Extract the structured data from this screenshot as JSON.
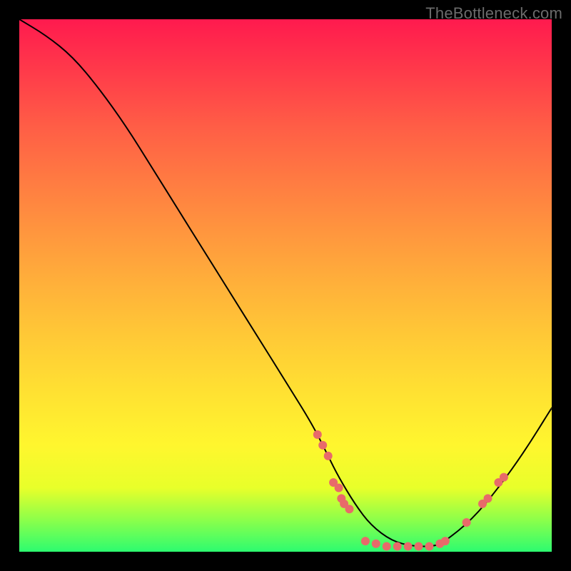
{
  "watermark": "TheBottleneck.com",
  "colors": {
    "background": "#000000",
    "gradient_top": "#ff1a4e",
    "gradient_bottom": "#2dfc70",
    "curve": "#000000",
    "points": "#e86a6a"
  },
  "chart_data": {
    "type": "line",
    "title": "",
    "xlabel": "",
    "ylabel": "",
    "xlim": [
      0,
      100
    ],
    "ylim": [
      0,
      100
    ],
    "curve": {
      "x": [
        0,
        5,
        10,
        15,
        20,
        25,
        30,
        35,
        40,
        45,
        50,
        55,
        58,
        60,
        63,
        66,
        70,
        74,
        78,
        80,
        85,
        90,
        95,
        100
      ],
      "y": [
        100,
        97,
        93,
        87,
        80,
        72,
        64,
        56,
        48,
        40,
        32,
        24,
        18,
        14,
        9,
        5,
        2,
        1,
        1,
        2,
        6,
        12,
        19,
        27
      ]
    },
    "scatter_points": [
      {
        "x": 56,
        "y": 22
      },
      {
        "x": 57,
        "y": 20
      },
      {
        "x": 58,
        "y": 18
      },
      {
        "x": 59,
        "y": 13
      },
      {
        "x": 60,
        "y": 12
      },
      {
        "x": 60.5,
        "y": 10
      },
      {
        "x": 61,
        "y": 9
      },
      {
        "x": 62,
        "y": 8
      },
      {
        "x": 65,
        "y": 2
      },
      {
        "x": 67,
        "y": 1.5
      },
      {
        "x": 69,
        "y": 1
      },
      {
        "x": 71,
        "y": 1
      },
      {
        "x": 73,
        "y": 1
      },
      {
        "x": 75,
        "y": 1
      },
      {
        "x": 77,
        "y": 1
      },
      {
        "x": 79,
        "y": 1.5
      },
      {
        "x": 80,
        "y": 2
      },
      {
        "x": 84,
        "y": 5.5
      },
      {
        "x": 87,
        "y": 9
      },
      {
        "x": 88,
        "y": 10
      },
      {
        "x": 90,
        "y": 13
      },
      {
        "x": 91,
        "y": 14
      }
    ],
    "notes": "Background is vertical rainbow gradient (red top → green bottom). Curve is a black U/V-shaped bottleneck curve with minimum near x≈74. Salmon-colored scatter points cluster along the lower portion of the curve. No axis ticks, labels, or numeric annotations are rendered in the image; all numeric values here are estimated from pixel positions. Axes assumed 0–100."
  }
}
